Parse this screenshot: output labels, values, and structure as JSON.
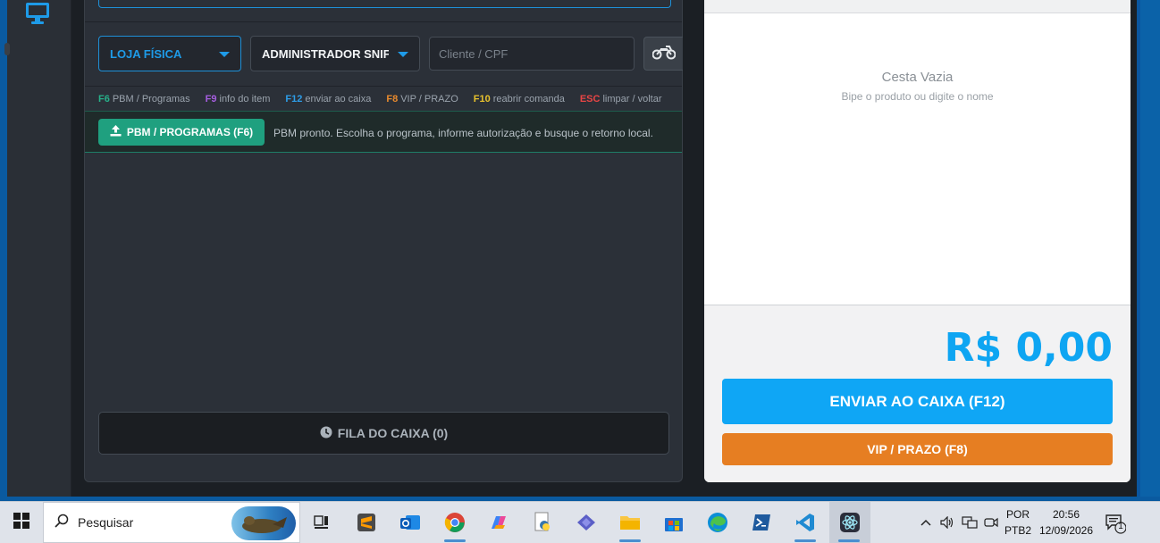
{
  "left_rail": {
    "icon": "desktop-monitor-icon"
  },
  "pdv": {
    "store_select": {
      "value": "LOJA FÍSICA"
    },
    "operator_select": {
      "value": "ADMINISTRADOR SNIF"
    },
    "client_input": {
      "placeholder": "Cliente / CPF",
      "value": ""
    },
    "delivery_button": {
      "icon": "motorcycle-icon"
    },
    "hotkeys": [
      {
        "key": "F6",
        "label": "PBM / Programas",
        "color": "#27b08a"
      },
      {
        "key": "F9",
        "label": "info do item",
        "color": "#a65ee0"
      },
      {
        "key": "F12",
        "label": "enviar ao caixa",
        "color": "#2d9de8"
      },
      {
        "key": "F8",
        "label": "VIP / PRAZO",
        "color": "#e88a2d"
      },
      {
        "key": "F10",
        "label": "reabrir comanda",
        "color": "#e8c22d"
      },
      {
        "key": "ESC",
        "label": "limpar / voltar",
        "color": "#e84545"
      }
    ],
    "pbm": {
      "button_label": "PBM / PROGRAMAS (F6)",
      "message": "PBM pronto. Escolha o programa, informe autorização e busque o retorno local."
    },
    "queue_button": {
      "label": "FILA DO CAIXA (0)",
      "icon": "clock-icon"
    }
  },
  "cart": {
    "empty_title": "Cesta Vazia",
    "empty_subtitle": "Bipe o produto ou digite o nome",
    "total": "R$ 0,00",
    "send_button": "ENVIAR AO CAIXA (F12)",
    "vip_button": "VIP / PRAZO (F8)"
  },
  "taskbar": {
    "search_label": "Pesquisar",
    "language": {
      "line1": "POR",
      "line2": "PTB2"
    },
    "clock": {
      "time": "20:56",
      "date": "12/09/2026"
    },
    "notification_count": "1"
  },
  "colors": {
    "accent_blue": "#0fa6f5",
    "vip_orange": "#e67e22",
    "pbm_green": "#1fa07f"
  }
}
